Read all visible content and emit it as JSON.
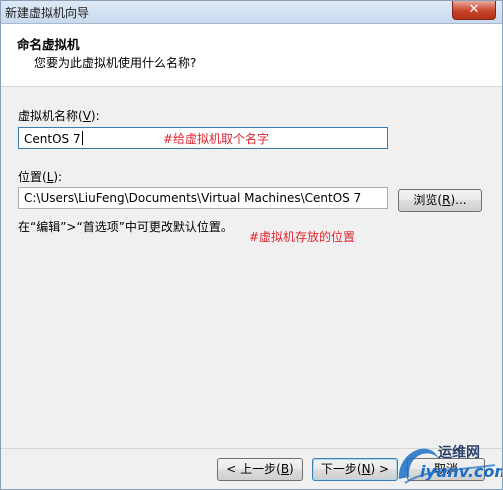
{
  "window": {
    "title": "新建虚拟机向导",
    "close_glyph": "✕"
  },
  "header": {
    "title": "命名虚拟机",
    "subtitle": "您要为此虚拟机使用什么名称?"
  },
  "vm_name": {
    "label_prefix": "虚拟机名称(",
    "label_key": "V",
    "label_suffix": "):",
    "value": "CentOS 7",
    "annotation": "#给虚拟机取个名字"
  },
  "location": {
    "label_prefix": "位置(",
    "label_key": "L",
    "label_suffix": "):",
    "value": "C:\\Users\\LiuFeng\\Documents\\Virtual Machines\\CentOS 7",
    "browse_prefix": "浏览(",
    "browse_key": "R",
    "browse_suffix": ")...",
    "hint": "在“编辑”>“首选项”中可更改默认位置。",
    "annotation": "#虚拟机存放的位置"
  },
  "footer": {
    "back_prefix": "< 上一步(",
    "back_key": "B",
    "back_suffix": ")",
    "next_prefix": "下一步(",
    "next_key": "N",
    "next_suffix": ") >",
    "cancel_label": "取消"
  },
  "watermark": {
    "line1": "运维网",
    "line2": "iyunv.com"
  }
}
